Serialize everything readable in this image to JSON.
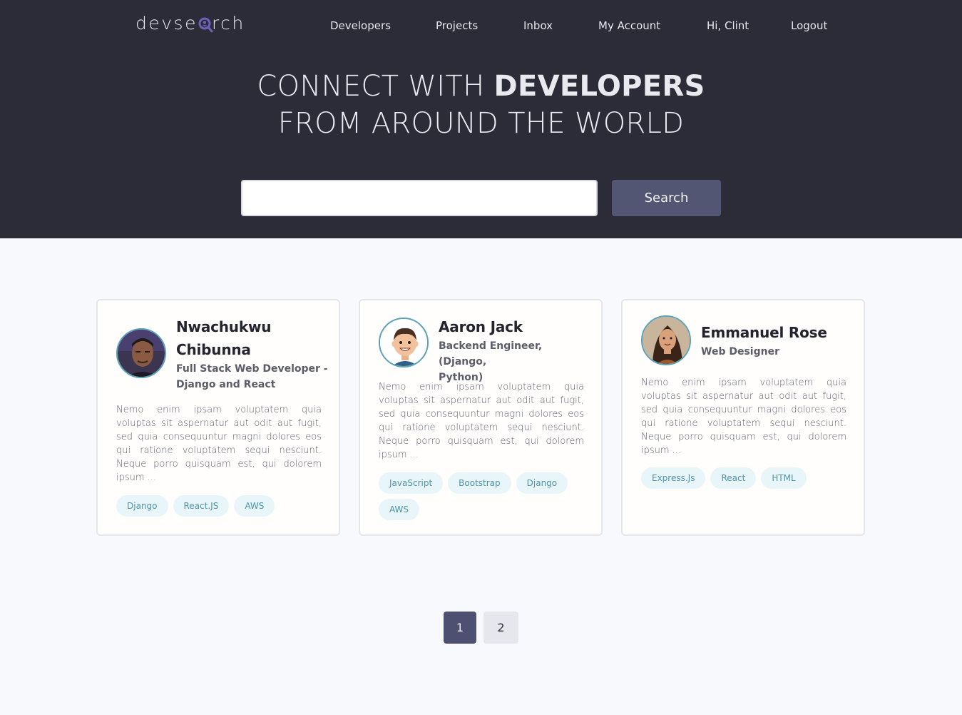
{
  "brand": {
    "logo_text_before": "devse",
    "logo_text_after": "rch"
  },
  "nav": {
    "items": [
      {
        "label": "Developers"
      },
      {
        "label": "Projects"
      },
      {
        "label": "Inbox"
      },
      {
        "label": "My Account"
      },
      {
        "label": "Hi, Clint"
      },
      {
        "label": "Logout"
      }
    ]
  },
  "hero": {
    "line1_light": "CONNECT WITH",
    "line1_bold": "DEVELOPERS",
    "line2": "FROM AROUND THE WORLD"
  },
  "search": {
    "value": "",
    "button_label": "Search"
  },
  "profiles": [
    {
      "name_line1": "Nwachukwu",
      "name_line2": "Chibunna",
      "role_line1": "Full Stack Web Developer -",
      "role_line2": "Django and React",
      "bio": "Nemo enim ipsam voluptatem quia voluptas sit aspernatur aut odit aut fugit, sed quia consequuntur magni dolores eos qui ratione voluptatem sequi nesciunt. Neque porro quisquam est, qui dolorem ipsum ...",
      "tags": [
        "Django",
        "React.JS",
        "AWS"
      ]
    },
    {
      "name_line1": "Aaron Jack",
      "role_line1": "Backend Engineer, (Django,",
      "role_line2": "Python)",
      "bio": "Nemo enim ipsam voluptatem quia voluptas sit aspernatur aut odit aut fugit, sed quia consequuntur magni dolores eos qui ratione voluptatem sequi nesciunt. Neque porro quisquam est, qui dolorem ipsum ...",
      "tags": [
        "JavaScript",
        "Bootstrap",
        "Django",
        "AWS"
      ]
    },
    {
      "name_line1": "Emmanuel Rose",
      "role_line1": "Web Designer",
      "bio": "Nemo enim ipsam voluptatem quia voluptas sit aspernatur aut odit aut fugit, sed quia consequuntur magni dolores eos qui ratione voluptatem sequi nesciunt. Neque porro quisquam est, qui dolorem ipsum ...",
      "tags": [
        "Express.Js",
        "React",
        "HTML"
      ]
    }
  ],
  "pagination": {
    "pages": [
      "1",
      "2"
    ],
    "current": "1"
  },
  "colors": {
    "header_bg": "#2b2c38",
    "button_bg": "#535672",
    "accent": "#5aa2b8",
    "tag_bg": "#e8f6fa",
    "tag_text": "#4f93a8"
  }
}
